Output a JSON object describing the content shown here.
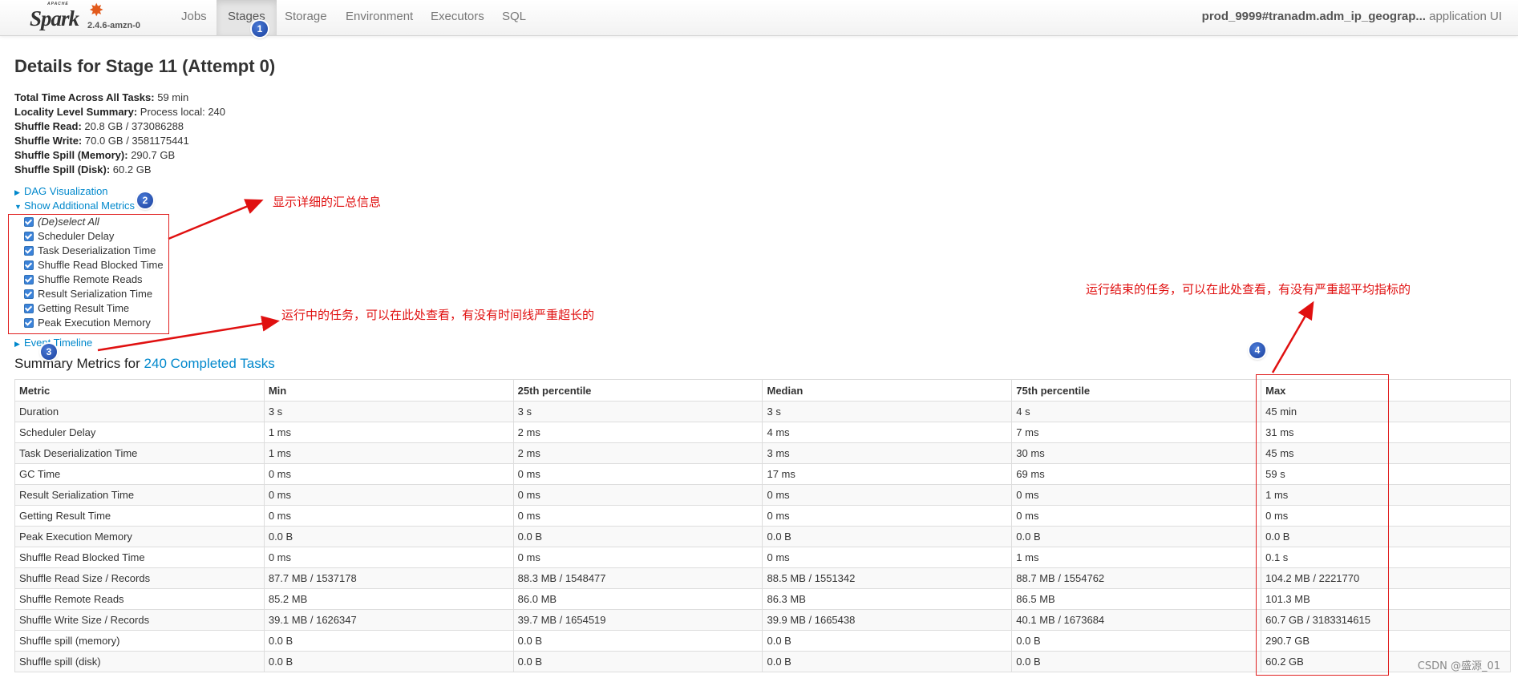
{
  "navbar": {
    "brand_top": "APACHE",
    "brand_name": "Spark",
    "version": "2.4.6-amzn-0",
    "tabs": [
      {
        "label": "Jobs"
      },
      {
        "label": "Stages"
      },
      {
        "label": "Storage"
      },
      {
        "label": "Environment"
      },
      {
        "label": "Executors"
      },
      {
        "label": "SQL"
      }
    ],
    "app_name": "prod_9999#tranadm.adm_ip_geograp...",
    "app_suffix": "application UI"
  },
  "page": {
    "title": "Details for Stage 11 (Attempt 0)",
    "info": [
      {
        "label": "Total Time Across All Tasks:",
        "value": "59 min"
      },
      {
        "label": "Locality Level Summary:",
        "value": "Process local: 240"
      },
      {
        "label": "Shuffle Read:",
        "value": "20.8 GB / 373086288"
      },
      {
        "label": "Shuffle Write:",
        "value": "70.0 GB / 3581175441"
      },
      {
        "label": "Shuffle Spill (Memory):",
        "value": "290.7 GB"
      },
      {
        "label": "Shuffle Spill (Disk):",
        "value": "60.2 GB"
      }
    ],
    "dag_link": "DAG Visualization",
    "additional_metrics_link": "Show Additional Metrics",
    "metrics_options": [
      "(De)select All",
      "Scheduler Delay",
      "Task Deserialization Time",
      "Shuffle Read Blocked Time",
      "Shuffle Remote Reads",
      "Result Serialization Time",
      "Getting Result Time",
      "Peak Execution Memory"
    ],
    "event_timeline_link": "Event Timeline",
    "summary_prefix": "Summary Metrics for ",
    "summary_link": "240 Completed Tasks"
  },
  "annotations": {
    "badge1": "1",
    "badge2": "2",
    "badge3": "3",
    "badge4": "4",
    "note2": "显示详细的汇总信息",
    "note3": "运行中的任务，可以在此处查看，有没有时间线严重超长的",
    "note4": "运行结束的任务，可以在此处查看，有没有严重超平均指标的"
  },
  "table": {
    "headers": [
      "Metric",
      "Min",
      "25th percentile",
      "Median",
      "75th percentile",
      "Max"
    ],
    "rows": [
      [
        "Duration",
        "3 s",
        "3 s",
        "3 s",
        "4 s",
        "45 min"
      ],
      [
        "Scheduler Delay",
        "1 ms",
        "2 ms",
        "4 ms",
        "7 ms",
        "31 ms"
      ],
      [
        "Task Deserialization Time",
        "1 ms",
        "2 ms",
        "3 ms",
        "30 ms",
        "45 ms"
      ],
      [
        "GC Time",
        "0 ms",
        "0 ms",
        "17 ms",
        "69 ms",
        "59 s"
      ],
      [
        "Result Serialization Time",
        "0 ms",
        "0 ms",
        "0 ms",
        "0 ms",
        "1 ms"
      ],
      [
        "Getting Result Time",
        "0 ms",
        "0 ms",
        "0 ms",
        "0 ms",
        "0 ms"
      ],
      [
        "Peak Execution Memory",
        "0.0 B",
        "0.0 B",
        "0.0 B",
        "0.0 B",
        "0.0 B"
      ],
      [
        "Shuffle Read Blocked Time",
        "0 ms",
        "0 ms",
        "0 ms",
        "1 ms",
        "0.1 s"
      ],
      [
        "Shuffle Read Size / Records",
        "87.7 MB / 1537178",
        "88.3 MB / 1548477",
        "88.5 MB / 1551342",
        "88.7 MB / 1554762",
        "104.2 MB / 2221770"
      ],
      [
        "Shuffle Remote Reads",
        "85.2 MB",
        "86.0 MB",
        "86.3 MB",
        "86.5 MB",
        "101.3 MB"
      ],
      [
        "Shuffle Write Size / Records",
        "39.1 MB / 1626347",
        "39.7 MB / 1654519",
        "39.9 MB / 1665438",
        "40.1 MB / 1673684",
        "60.7 GB / 3183314615"
      ],
      [
        "Shuffle spill (memory)",
        "0.0 B",
        "0.0 B",
        "0.0 B",
        "0.0 B",
        "290.7 GB"
      ],
      [
        "Shuffle spill (disk)",
        "0.0 B",
        "0.0 B",
        "0.0 B",
        "0.0 B",
        "60.2 GB"
      ]
    ]
  },
  "watermark": "CSDN @盛源_01",
  "colors": {
    "link": "#0088cc",
    "annotation_red": "#e01010",
    "badge_blue": "#1a3f9c",
    "spark_orange": "#e25a1c"
  }
}
